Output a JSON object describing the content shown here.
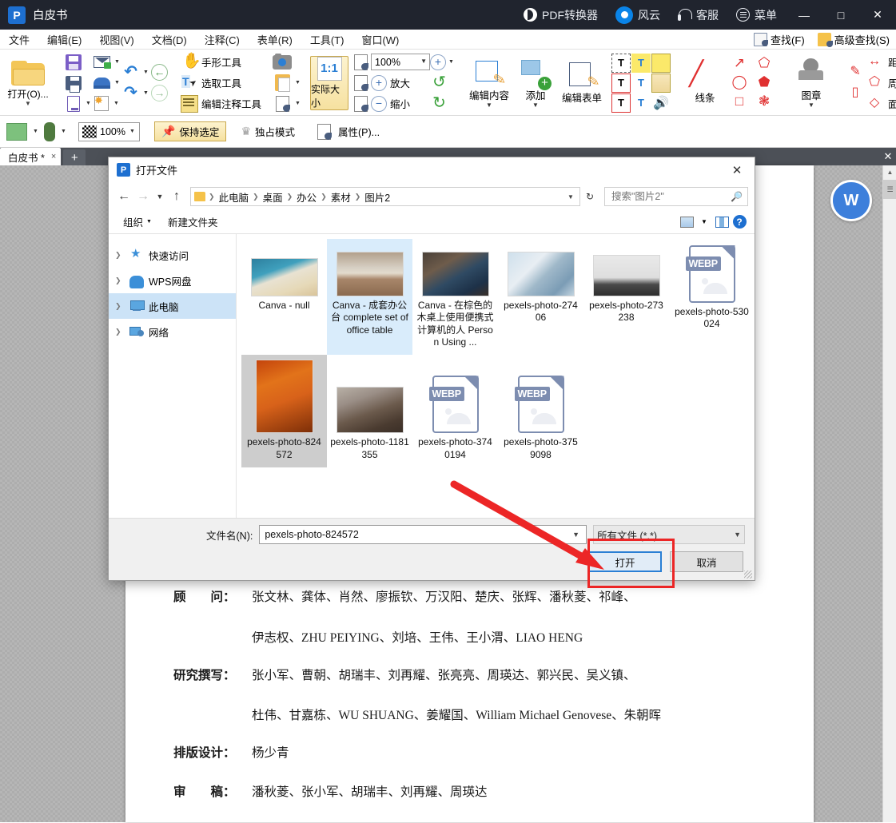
{
  "titlebar": {
    "app_title": "白皮书",
    "logo_glyph": "P",
    "items": [
      {
        "label": "PDF转换器",
        "icon": "pdf-converter-icon"
      },
      {
        "label": "风云",
        "icon": "fengyun-icon"
      },
      {
        "label": "客服",
        "icon": "headset-icon"
      },
      {
        "label": "菜单",
        "icon": "menu-icon"
      }
    ],
    "minimize": "—",
    "maximize": "□",
    "close": "✕"
  },
  "menubar": {
    "items": [
      "文件",
      "编辑(E)",
      "视图(V)",
      "文档(D)",
      "注释(C)",
      "表单(R)",
      "工具(T)",
      "窗口(W)"
    ],
    "find": "查找(F)",
    "advanced_find": "高级查找(S)"
  },
  "ribbon": {
    "open_label": "打开(O)...",
    "hand_tool": "手形工具",
    "select_tool": "选取工具",
    "edit_annot_tool": "编辑注释工具",
    "actual_size": "实际大小",
    "actual_size_ratio": "1:1",
    "zoom_value": "100%",
    "zoom_in": "放大",
    "zoom_out": "缩小",
    "edit_content": "编辑内容",
    "add": "添加",
    "edit_form": "编辑表单",
    "line": "线条",
    "stamp": "图章",
    "distance": "距离",
    "perimeter": "周长",
    "area": "面积"
  },
  "ribbon2": {
    "opacity": "100%",
    "keep_selected": "保持选定",
    "exclusive_mode": "独占模式",
    "properties": "属性(P)..."
  },
  "tabstrip": {
    "doc_tab": "白皮书 *",
    "close_tab": "×",
    "new_tab": "+",
    "close_all": "✕"
  },
  "dialog": {
    "title": "打开文件",
    "logo_glyph": "P",
    "close": "✕",
    "nav": {
      "back": "←",
      "forward": "→",
      "recent": "⌄",
      "up": "↑",
      "breadcrumbs": [
        "此电脑",
        "桌面",
        "办公",
        "素材",
        "图片2"
      ],
      "refresh": "↻",
      "search_placeholder": "搜索\"图片2\"",
      "search_value": ""
    },
    "commands": {
      "organize": "组织",
      "new_folder": "新建文件夹",
      "view_icon": "view-layout-icon",
      "pane_icon": "preview-pane-icon",
      "help_icon": "help-icon"
    },
    "tree": [
      {
        "label": "快速访问",
        "icon": "quick-access-icon",
        "selected": false
      },
      {
        "label": "WPS网盘",
        "icon": "wps-cloud-icon",
        "selected": false
      },
      {
        "label": "此电脑",
        "icon": "this-pc-icon",
        "selected": true
      },
      {
        "label": "网络",
        "icon": "network-icon",
        "selected": false
      }
    ],
    "files": [
      {
        "name": "Canva - null",
        "kind": "image",
        "state": "none",
        "thumb": "ocean-beach"
      },
      {
        "name": "Canva - 成套办公台 complete set of office table",
        "kind": "image",
        "state": "selected",
        "thumb": "desk-window"
      },
      {
        "name": "Canva - 在棕色的木桌上使用便携式计算机的人 Person Using ...",
        "kind": "image",
        "state": "none",
        "thumb": "laptop-meeting"
      },
      {
        "name": "pexels-photo-27406",
        "kind": "image",
        "state": "none",
        "thumb": "sky-building"
      },
      {
        "name": "pexels-photo-273238",
        "kind": "image",
        "state": "none",
        "thumb": "plant-desk"
      },
      {
        "name": "pexels-photo-530024",
        "kind": "webp",
        "state": "none",
        "thumb": "webp"
      },
      {
        "name": "pexels-photo-824572",
        "kind": "image",
        "state": "ghost-selected",
        "thumb": "orange-plant"
      },
      {
        "name": "pexels-photo-1181355",
        "kind": "image",
        "state": "none",
        "thumb": "conference-room"
      },
      {
        "name": "pexels-photo-3740194",
        "kind": "webp",
        "state": "none",
        "thumb": "webp"
      },
      {
        "name": "pexels-photo-3759098",
        "kind": "webp",
        "state": "none",
        "thumb": "webp"
      }
    ],
    "webp_label": "WEBP",
    "footer": {
      "filename_label": "文件名(N):",
      "filename_value": "pexels-photo-824572",
      "filetype_value": "所有文件 (*.*)",
      "open_button": "打开",
      "cancel_button": "取消"
    }
  },
  "document": {
    "rows": [
      {
        "label": "顾　　问：",
        "text": "张文林、龚体、肖然、廖振钦、万汉阳、楚庆、张辉、潘秋菱、祁峰、"
      },
      {
        "indent": "伊志权、ZHU PEIYING、刘培、王伟、王小渭、LIAO HENG"
      },
      {
        "label": "研究撰写：",
        "text": "张小军、曹朝、胡瑞丰、刘再耀、张亮亮、周瑛达、郭兴民、吴义镇、"
      },
      {
        "indent": "杜伟、甘嘉栋、WU SHUANG、姜耀国、William Michael Genovese、朱朝晖"
      },
      {
        "label": "排版设计：",
        "text": "杨少青"
      },
      {
        "label": "审　　稿：",
        "text": "潘秋菱、张小军、胡瑞丰、刘再耀、周瑛达"
      }
    ]
  },
  "colors": {
    "titlebar_bg": "#20242e",
    "accent_blue": "#1d6fd0",
    "annotation_red": "#ec2626",
    "selection_blue": "#cce3f7",
    "workspace_gray": "#b3b3b3"
  }
}
